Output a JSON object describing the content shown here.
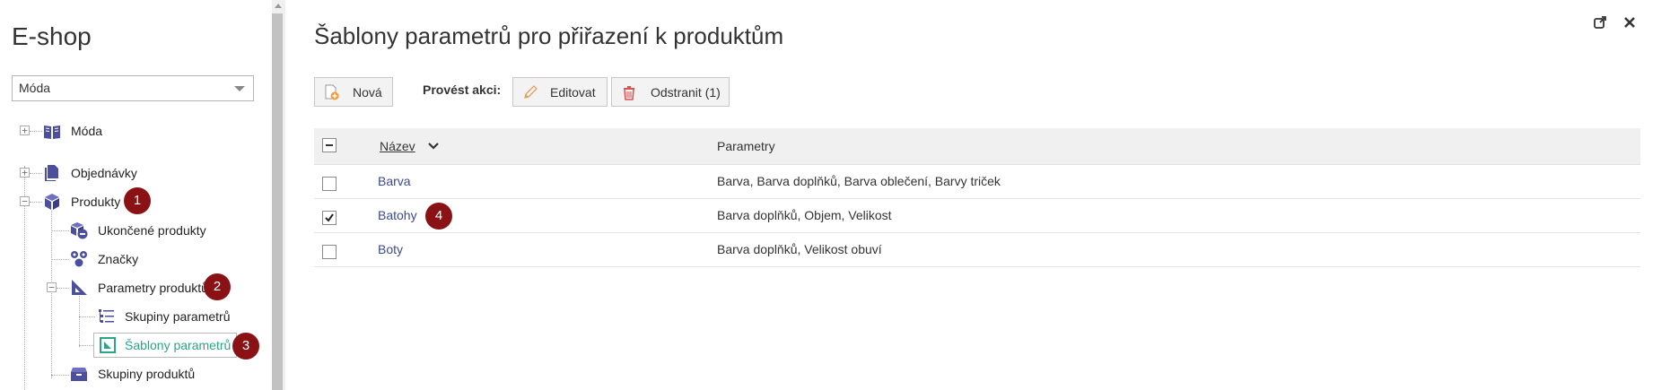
{
  "left_panel": {
    "title": "E-shop",
    "select_value": "Móda",
    "tree": [
      {
        "label": "Móda",
        "icon": "book-icon"
      },
      {
        "label": "Objednávky",
        "icon": "documents-icon"
      },
      {
        "label": "Produkty",
        "icon": "cube-icon"
      },
      {
        "label": "Ukončené produkty",
        "icon": "cube-stop-icon"
      },
      {
        "label": "Značky",
        "icon": "circles-icon"
      },
      {
        "label": "Parametry produktů",
        "icon": "set-square-icon"
      },
      {
        "label": "Skupiny parametrů",
        "icon": "list-icon"
      },
      {
        "label": "Šablony parametrů",
        "icon": "template-icon"
      },
      {
        "label": "Skupiny produktů",
        "icon": "box-icon"
      }
    ]
  },
  "markers": [
    "1",
    "2",
    "3",
    "4"
  ],
  "main": {
    "title": "Šablony parametrů pro přiřazení k produktům",
    "toolbar": {
      "new_label": "Nová",
      "action_label": "Provést akci:",
      "edit_label": "Editovat",
      "delete_label": "Odstranit (1)"
    },
    "table": {
      "headers": {
        "name": "Název",
        "params": "Parametry"
      },
      "rows": [
        {
          "name": "Barva",
          "params": "Barva, Barva doplňků, Barva oblečení, Barvy triček",
          "checked": false
        },
        {
          "name": "Batohy",
          "params": "Barva doplňků, Objem, Velikost",
          "checked": true
        },
        {
          "name": "Boty",
          "params": "Barva doplňků, Velikost obuví",
          "checked": false
        }
      ]
    }
  },
  "colors": {
    "marker": "#8b1214",
    "link": "#3c4a8f",
    "active": "#2aa58a",
    "icon": "#4b4f9e"
  }
}
